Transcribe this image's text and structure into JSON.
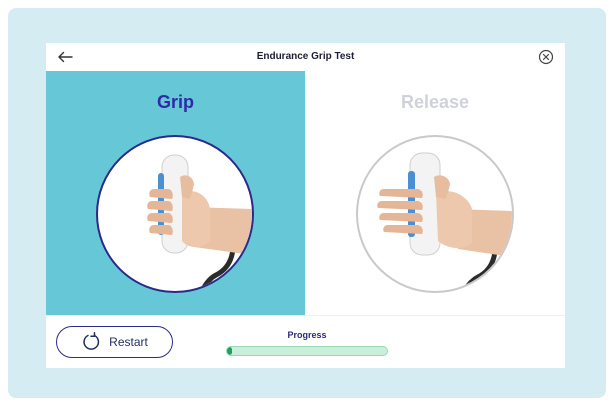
{
  "header": {
    "title": "Endurance Grip Test",
    "back_icon": "arrow-left-icon",
    "close_icon": "close-circle-icon"
  },
  "panes": {
    "grip": {
      "label": "Grip",
      "icon": "hand-gripping-device-icon",
      "active": true
    },
    "release": {
      "label": "Release",
      "icon": "hand-releasing-device-icon",
      "active": false
    }
  },
  "footer": {
    "restart_label": "Restart",
    "restart_icon": "restart-icon",
    "progress_label": "Progress",
    "progress_fraction": 0.02
  },
  "colors": {
    "panel_bg": "#d6ecf3",
    "active_pane": "#66c8d6",
    "grip_label": "#2f2aa8",
    "release_label": "#cfd2da",
    "progress_fill": "#1fa05c",
    "progress_track": "#c9efda"
  }
}
